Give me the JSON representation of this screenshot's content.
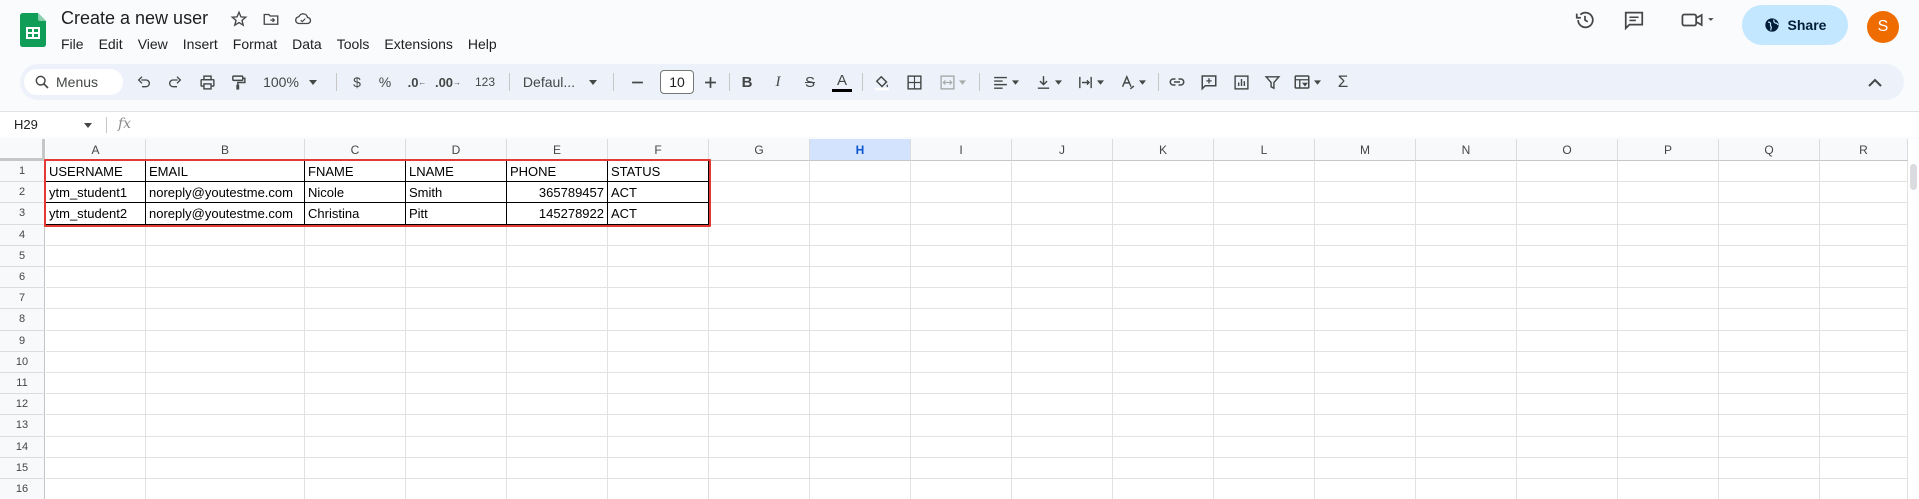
{
  "app": {
    "doc_title": "Create a new user",
    "menu": [
      "File",
      "Edit",
      "View",
      "Insert",
      "Format",
      "Data",
      "Tools",
      "Extensions",
      "Help"
    ],
    "share_label": "Share",
    "avatar_initial": "S"
  },
  "toolbar": {
    "menus_label": "Menus",
    "zoom": "100%",
    "currency": "$",
    "percent": "%",
    "dec_decrease": ".0",
    "dec_increase": ".00",
    "number_format": "123",
    "font": "Defaul...",
    "font_size": "10",
    "bold": "B",
    "italic": "I",
    "strike": "S",
    "text_color": "A",
    "sigma": "Σ"
  },
  "formula_bar": {
    "name_box": "H29",
    "fx": "fx",
    "value": ""
  },
  "sheet": {
    "selected_column": "H",
    "columns": [
      "A",
      "B",
      "C",
      "D",
      "E",
      "F",
      "G",
      "H",
      "I",
      "J",
      "K",
      "L",
      "M",
      "N",
      "O",
      "P",
      "Q",
      "R"
    ],
    "rows": [
      "1",
      "2",
      "3",
      "4",
      "5",
      "6",
      "7",
      "8",
      "9",
      "10",
      "11",
      "12",
      "13",
      "14",
      "15",
      "16"
    ],
    "headers": [
      "USERNAME",
      "EMAIL",
      "FNAME",
      "LNAME",
      "PHONE",
      "STATUS"
    ],
    "data": [
      [
        "ytm_student1",
        "noreply@youtestme.com",
        "Nicole",
        "Smith",
        "365789457",
        "ACT"
      ],
      [
        "ytm_student2",
        "noreply@youtestme.com",
        "Christina",
        "Pitt",
        "145278922",
        "ACT"
      ]
    ]
  },
  "colors": {
    "highlight": "#e53935",
    "share_bg": "#c2e7ff",
    "avatar_bg": "#ef6c00",
    "sheets_green": "#0f9d58",
    "selected_col": "#d3e3fd"
  }
}
